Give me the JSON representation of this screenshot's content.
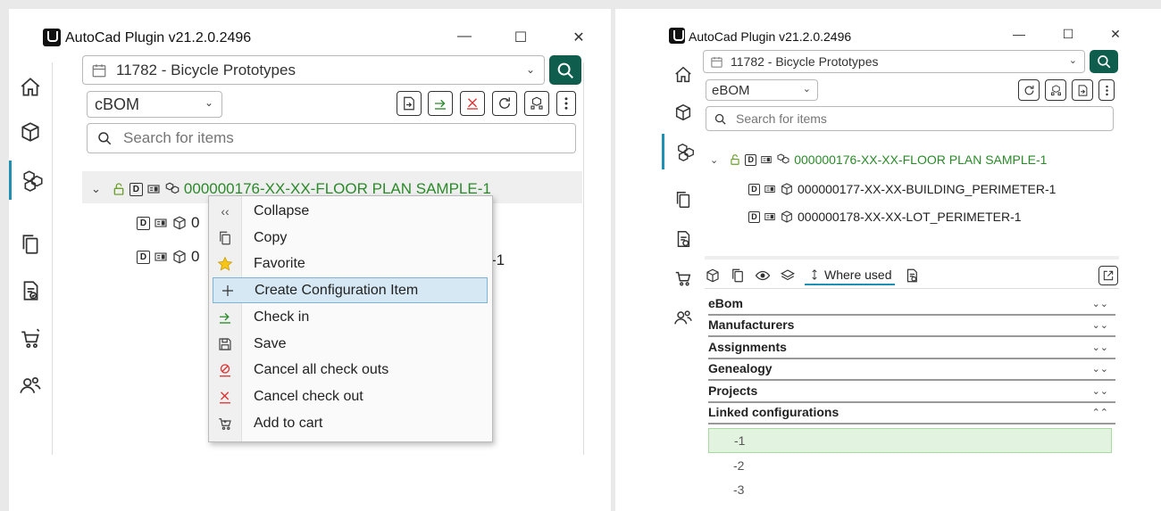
{
  "window_title": "AutoCad Plugin v21.2.0.2496",
  "window_controls": {
    "minimize": "—",
    "maximize": "☐",
    "close": "✕"
  },
  "project_select": {
    "value": "11782 - Bicycle Prototypes"
  },
  "left": {
    "bom_select": {
      "value": "cBOM"
    },
    "search": {
      "placeholder": "Search for items"
    },
    "tree": {
      "root": "000000176-XX-XX-FLOOR PLAN SAMPLE-1",
      "child1_partial": "0",
      "child2_partial": "0",
      "child2_tail": "-1"
    },
    "context_menu": [
      {
        "label": "Collapse",
        "icon": "double-chevron-left-icon"
      },
      {
        "label": "Copy",
        "icon": "copy-icon"
      },
      {
        "label": "Favorite",
        "icon": "star-icon"
      },
      {
        "label": "Create Configuration Item",
        "icon": "plus-icon",
        "selected": true
      },
      {
        "label": "Check in",
        "icon": "check-in-icon"
      },
      {
        "label": "Save",
        "icon": "save-icon"
      },
      {
        "label": "Cancel all check outs",
        "icon": "cancel-all-icon"
      },
      {
        "label": "Cancel check out",
        "icon": "cancel-icon"
      },
      {
        "label": "Add to cart",
        "icon": "cart-icon"
      }
    ]
  },
  "right": {
    "bom_select": {
      "value": "eBOM"
    },
    "search": {
      "placeholder": "Search for items"
    },
    "tree": {
      "root": "000000176-XX-XX-FLOOR PLAN SAMPLE-1",
      "children": [
        "000000177-XX-XX-BUILDING_PERIMETER-1",
        "000000178-XX-XX-LOT_PERIMETER-1"
      ]
    },
    "tabs": {
      "where_used": "Where used"
    },
    "sections": [
      {
        "label": "eBom",
        "expanded": false
      },
      {
        "label": "Manufacturers",
        "expanded": false
      },
      {
        "label": "Assignments",
        "expanded": false
      },
      {
        "label": "Genealogy",
        "expanded": false
      },
      {
        "label": "Projects",
        "expanded": false
      },
      {
        "label": "Linked configurations",
        "expanded": true
      }
    ],
    "linked_configurations": [
      "-1",
      "-2",
      "-3"
    ]
  },
  "colors": {
    "accent": "#0e5d4d",
    "tree_green": "#2a8a2a",
    "selection_blue": "#d5e8f3",
    "selection_green": "#e2f4e0"
  }
}
